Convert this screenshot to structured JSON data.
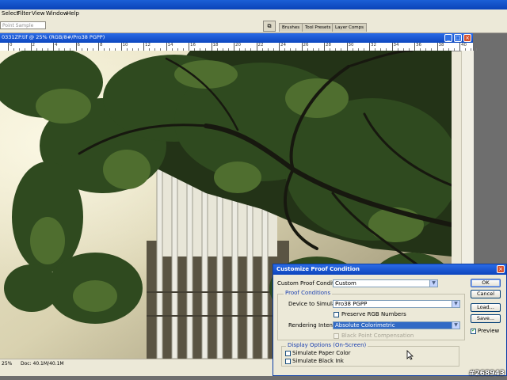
{
  "menu": [
    "Select",
    "Filter",
    "View",
    "Window",
    "Help"
  ],
  "options": {
    "sample_select": "Point Sample",
    "palette_tabs": [
      "Brushes",
      "Tool Presets",
      "Layer Comps"
    ]
  },
  "document": {
    "title": "0331ZP.tif @ 25% (RGB/8#/Pro38 PGPP)",
    "ruler_numbers": [
      "0",
      "2",
      "4",
      "6",
      "8",
      "10",
      "12",
      "14",
      "16",
      "18",
      "20",
      "22",
      "24",
      "26",
      "28",
      "30",
      "32",
      "34",
      "36",
      "38",
      "40"
    ],
    "status_zoom": "25%",
    "doc_size": "Doc: 40.1M/40.1M"
  },
  "dialog": {
    "title": "Customize Proof Condition",
    "custom_label": "Custom Proof Condition:",
    "custom_value": "Custom",
    "proof_group_title": "Proof Conditions",
    "device_label": "Device to Simulate:",
    "device_value": "Pro38 PGPP",
    "preserve_rgb": "Preserve RGB Numbers",
    "rendering_label": "Rendering Intent:",
    "rendering_value": "Absolute Colorimetric",
    "black_point": "Black Point Compensation",
    "display_group_title": "Display Options (On-Screen)",
    "sim_paper": "Simulate Paper Color",
    "sim_black": "Simulate Black Ink",
    "buttons": {
      "ok": "OK",
      "cancel": "Cancel",
      "load": "Load...",
      "save": "Save..."
    },
    "preview_label": "Preview",
    "checked": {
      "preserve_rgb": false,
      "black_point": false,
      "sim_paper": false,
      "sim_black": false,
      "preview": true
    }
  },
  "watermark": "#268943",
  "colors": {
    "titlebar": "#0d47c0",
    "dialog_bg": "#ece9d8",
    "selection": "#316ac5"
  }
}
